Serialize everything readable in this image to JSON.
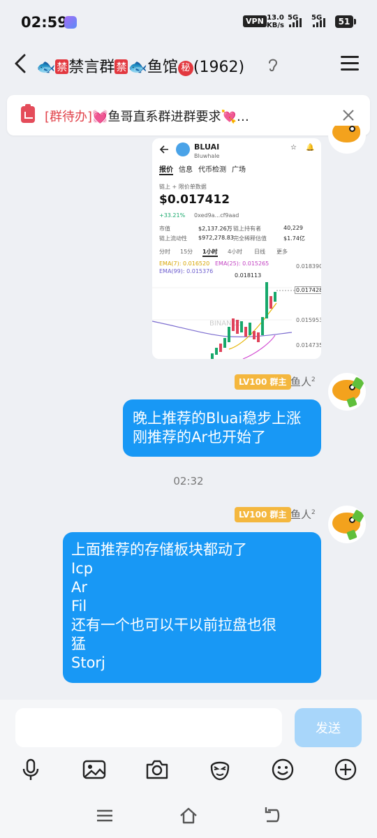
{
  "status_bar": {
    "time": "02:59",
    "vpn": "VPN",
    "speed_value": "13.0",
    "speed_unit": "KB/s",
    "sim1": "5G",
    "sim2": "5G",
    "battery": "51"
  },
  "header": {
    "title_prefix_fish": "🐟",
    "title_ban1": "禁",
    "title_mid": "禁言群",
    "title_ban2": "禁",
    "title_fish2": "🐟",
    "title_tail": "鱼馆",
    "title_secret": "秘",
    "member_count": "(1962)"
  },
  "pinned": {
    "tag": "[群待办]",
    "text": "💓鱼哥直系群进群要求💘…"
  },
  "image_card": {
    "token": "BLUAI",
    "token_sub": "Bluwhale",
    "tabs": [
      "报价",
      "信息",
      "代币检测",
      "广场"
    ],
    "price_label": "链上 + 限价单数据",
    "price": "$0.017412",
    "change": "+33.21%",
    "address": "0xed9a...cf9aad",
    "stats": [
      {
        "label": "市值",
        "value": "$2,137.26万"
      },
      {
        "label": "链上持有者",
        "value": "40,229"
      },
      {
        "label": "链上流动性",
        "value": "$972,278.83"
      },
      {
        "label": "完全稀释估值",
        "value": "$1.74亿"
      }
    ],
    "intervals": [
      "分时",
      "15分",
      "1小时",
      "4小时",
      "日线",
      "更多"
    ],
    "ema7": "EMA(7): 0.016520",
    "ema25": "EMA(25): 0.015265",
    "ema99": "EMA(99): 0.015376",
    "price_ticks": [
      "0.018390",
      "0.017428",
      "0.015953",
      "0.014735"
    ],
    "high_mark": "0.018113",
    "watermark": "BINANCE"
  },
  "messages": [
    {
      "badge": "LV100 群主",
      "sender": "鱼人",
      "sender_sup": "2",
      "lines": [
        "晚上推荐的Bluai稳步上涨",
        "刚推荐的Ar也开始了"
      ]
    },
    {
      "badge": "LV100 群主",
      "sender": "鱼人",
      "sender_sup": "2",
      "lines": [
        "上面推荐的存储板块都动了",
        "Icp",
        "Ar",
        "Fil",
        "还有一个也可以干以前拉盘也很",
        "猛",
        "Storj"
      ]
    }
  ],
  "timestamp": "02:32",
  "composer": {
    "placeholder": "",
    "send_label": "发送"
  },
  "colors": {
    "accent": "#1898f5",
    "badge": "#f4b73e",
    "alert": "#e1434b"
  }
}
